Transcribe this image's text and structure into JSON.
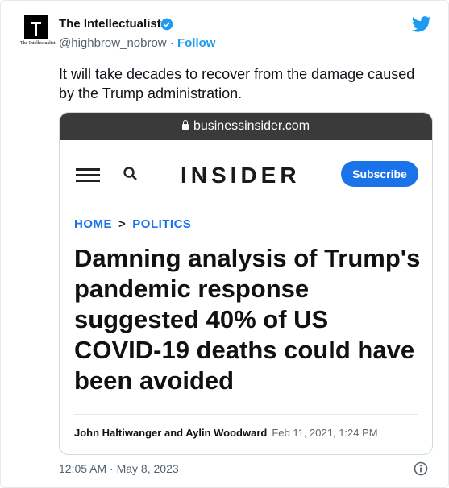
{
  "account": {
    "name": "The Intellectualist",
    "handle": "@highbrow_nobrow",
    "separator": "·",
    "follow_label": "Follow",
    "avatar_text": "The Intellectualist"
  },
  "tweet": {
    "text": "It will take decades to recover from the damage caused by the Trump administration.",
    "timestamp": "12:05 AM · May 8, 2023"
  },
  "card": {
    "url": "businessinsider.com",
    "site_logo": "INSIDER",
    "subscribe_label": "Subscribe",
    "breadcrumb": {
      "home": "HOME",
      "sep": ">",
      "section": "POLITICS"
    },
    "headline": "Damning analysis of Trump's pandemic response suggested 40% of US COVID-19 deaths could have been avoided",
    "authors": "John Haltiwanger and Aylin Woodward",
    "date": "Feb 11, 2021, 1:24 PM"
  },
  "colors": {
    "accent": "#1d9bf0",
    "subscribe": "#1a73e8",
    "urlbar": "#3a3a3a"
  },
  "icons": [
    "verified-badge-icon",
    "twitter-bird-icon",
    "lock-icon",
    "menu-icon",
    "search-icon",
    "info-icon"
  ]
}
